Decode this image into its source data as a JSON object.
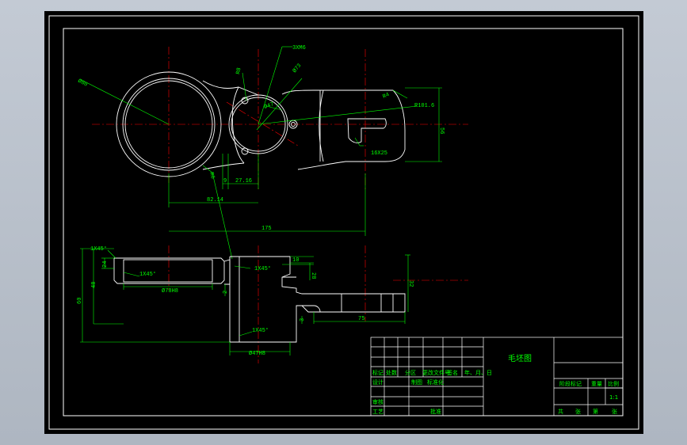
{
  "drawing": {
    "colors": {
      "part": "#ffffff",
      "dimension": "#00ff00",
      "centerline": "#ff0000",
      "background": "#000000"
    },
    "top_view": {
      "dims": {
        "d_left_circle": "Ø80",
        "holes": "3XM6",
        "d_mid": "Ø73",
        "r_small": "R8",
        "r_large": "R4",
        "d_bore": "Ø47",
        "r_end": "R101.6",
        "height": "56",
        "slot": "16X25",
        "r_web": "R6",
        "dim_9": "9",
        "dim_27": "27.16",
        "dim_82": "82.14",
        "dim_175": "175"
      }
    },
    "front_view": {
      "dims": {
        "chamfer_top": "1X45°",
        "dim_24": "24",
        "chamfer_in": "1X45°",
        "dim_48": "48",
        "dim_60": "60",
        "d_bottom": "Ø78H8",
        "chamfer_mid": "1X45°",
        "dim_2": "2",
        "dim_28": "28",
        "dim_10": "10",
        "dim_32": "32",
        "dim_3": "3",
        "dim_75": "75",
        "chamfer_bot": "1X45°",
        "d_boss": "Ø47H8"
      }
    }
  },
  "title_block": {
    "title": "毛坯图",
    "row_labels": {
      "a": "标记",
      "b": "处数",
      "c": "分区",
      "d": "更改文件号",
      "e": "签名",
      "f": "年、月、日"
    },
    "design": "设计",
    "std": "标准化",
    "sign": "制图",
    "review": "审核",
    "process": "工艺",
    "approve": "批准",
    "stage": "阶段标记",
    "weight": "重量",
    "scale_label": "比例",
    "scale": "1:1",
    "sheet_total": "共",
    "sheet_of": "张",
    "sheet_no": "第",
    "sheet_unit": "张"
  }
}
